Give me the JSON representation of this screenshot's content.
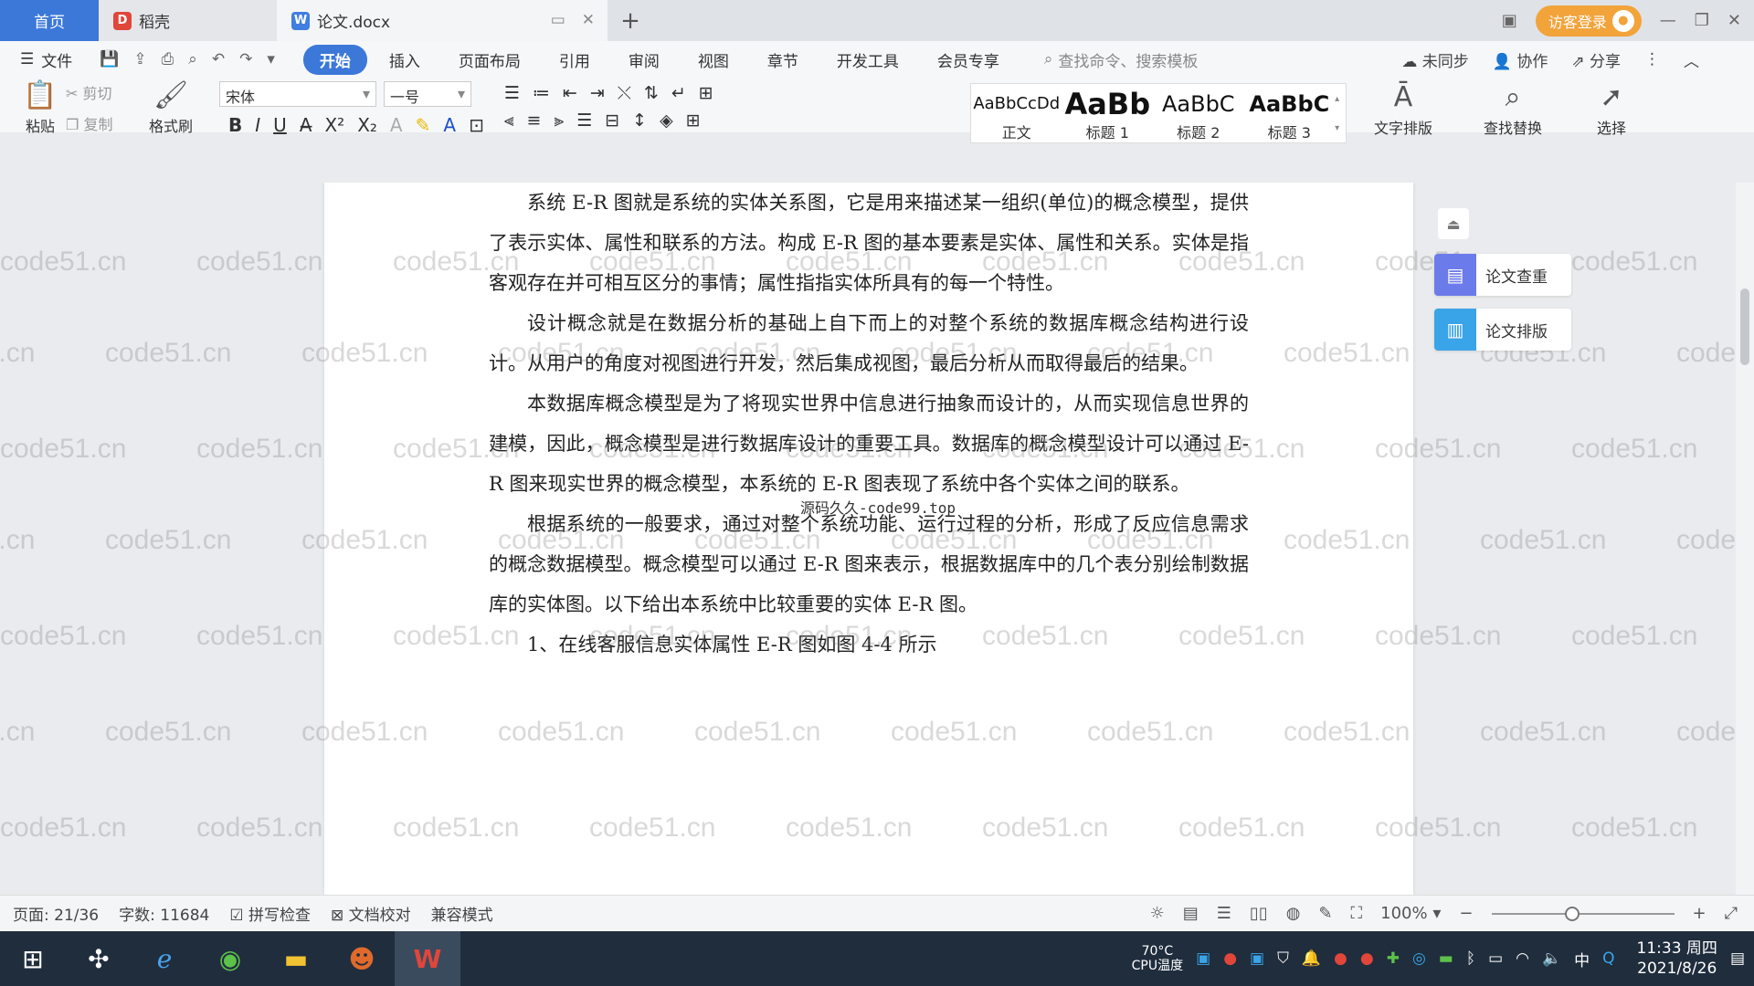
{
  "tabs": {
    "home": "首页",
    "docer": "稻壳",
    "document": "论文.docx"
  },
  "login": "访客登录",
  "menu": {
    "file": "文件",
    "items": [
      "开始",
      "插入",
      "页面布局",
      "引用",
      "审阅",
      "视图",
      "章节",
      "开发工具",
      "会员专享"
    ],
    "search_placeholder": "查找命令、搜索模板",
    "sync": "未同步",
    "collab": "协作",
    "share": "分享"
  },
  "ribbon": {
    "paste": "粘贴",
    "cut": "剪切",
    "copy": "复制",
    "format_painter": "格式刷",
    "font": "宋体",
    "font_size": "一号",
    "styles": [
      {
        "sample": "AaBbCcDd",
        "name": "正文"
      },
      {
        "sample": "AaBb",
        "name": "标题 1"
      },
      {
        "sample": "AaBbC",
        "name": "标题 2"
      },
      {
        "sample": "AaBbC",
        "name": "标题 3"
      }
    ],
    "text_layout": "文字排版",
    "find_replace": "查找替换",
    "select": "选择"
  },
  "side_panel": {
    "check": "论文查重",
    "layout": "论文排版"
  },
  "document": {
    "paragraphs": [
      "系统 E-R 图就是系统的实体关系图，它是用来描述某一组织(单位)的概念模型，提供了表示实体、属性和联系的方法。构成 E-R 图的基本要素是实体、属性和关系。实体是指客观存在并可相互区分的事情；属性指指实体所具有的每一个特性。",
      "设计概念就是在数据分析的基础上自下而上的对整个系统的数据库概念结构进行设计。从用户的角度对视图进行开发，然后集成视图，最后分析从而取得最后的结果。",
      "本数据库概念模型是为了将现实世界中信息进行抽象而设计的，从而实现信息世界的建模，因此，概念模型是进行数据库设计的重要工具。数据库的概念模型设计可以通过 E-R 图来现实世界的概念模型，本系统的 E-R 图表现了系统中各个实体之间的联系。",
      "根据系统的一般要求，通过对整个系统功能、运行过程的分析，形成了反应信息需求的概念数据模型。概念模型可以通过 E-R 图来表示，根据数据库中的几个表分别绘制数据库的实体图。以下给出本系统中比较重要的实体 E-R 图。",
      "1、在线客服信息实体属性 E-R 图如图 4-4 所示"
    ],
    "overlay": "源码久久-code99.top",
    "watermark": "code51.cn"
  },
  "status": {
    "page": "页面: 21/36",
    "words": "字数: 11684",
    "spell": "拼写检查",
    "proof": "文档校对",
    "compat": "兼容模式",
    "zoom": "100%",
    "zoom_fraction": 0.44
  },
  "taskbar": {
    "cpu_temp": "70°C",
    "cpu_label": "CPU温度",
    "ime": "中",
    "time": "11:33 周四",
    "date": "2021/8/26"
  },
  "colors": {
    "accent": "#3c78d8",
    "login": "#f2a33a"
  }
}
